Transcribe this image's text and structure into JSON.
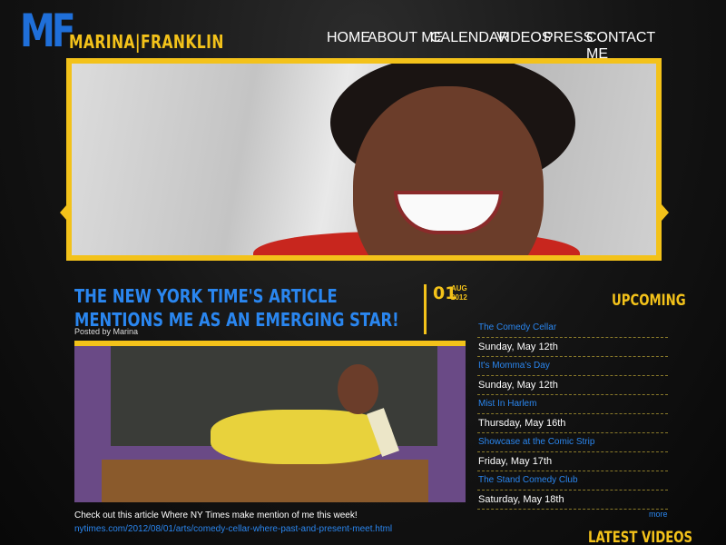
{
  "logo": {
    "mark": "MF",
    "name": "MARINA|FRANKLIN"
  },
  "nav": [
    {
      "label": "HOME"
    },
    {
      "label": "ABOUT ME"
    },
    {
      "label": "CALENDAR"
    },
    {
      "label": "VIDEOS"
    },
    {
      "label": "PRESS"
    },
    {
      "label": "CONTACT ME"
    }
  ],
  "post": {
    "title": "THE NEW YORK TIME'S ARTICLE MENTIONS ME AS AN EMERGING STAR!",
    "posted_by": "Posted by Marina",
    "date_day": "01",
    "date_month": "AUG",
    "date_year": "2012",
    "body": " Check out this article Where NY Times make mention of me this week!",
    "link": "nytimes.com/2012/08/01/arts/comedy-cellar-where-past-and-present-meet.html"
  },
  "upcoming": {
    "title": "UPCOMING",
    "events": [
      {
        "name": "The Comedy Cellar",
        "date": "Sunday, May 12th"
      },
      {
        "name": "It's Momma's Day",
        "date": "Sunday, May 12th"
      },
      {
        "name": "Mist In Harlem",
        "date": "Thursday, May 16th"
      },
      {
        "name": "Showcase at the Comic Strip",
        "date": "Friday, May 17th"
      },
      {
        "name": "The Stand Comedy Club",
        "date": "Saturday, May 18th"
      }
    ],
    "more": "more"
  },
  "latest_videos": {
    "title": "LATEST VIDEOS"
  },
  "colors": {
    "accent": "#f3c21a",
    "link": "#2a86ef",
    "background": "#0e0e0e"
  }
}
